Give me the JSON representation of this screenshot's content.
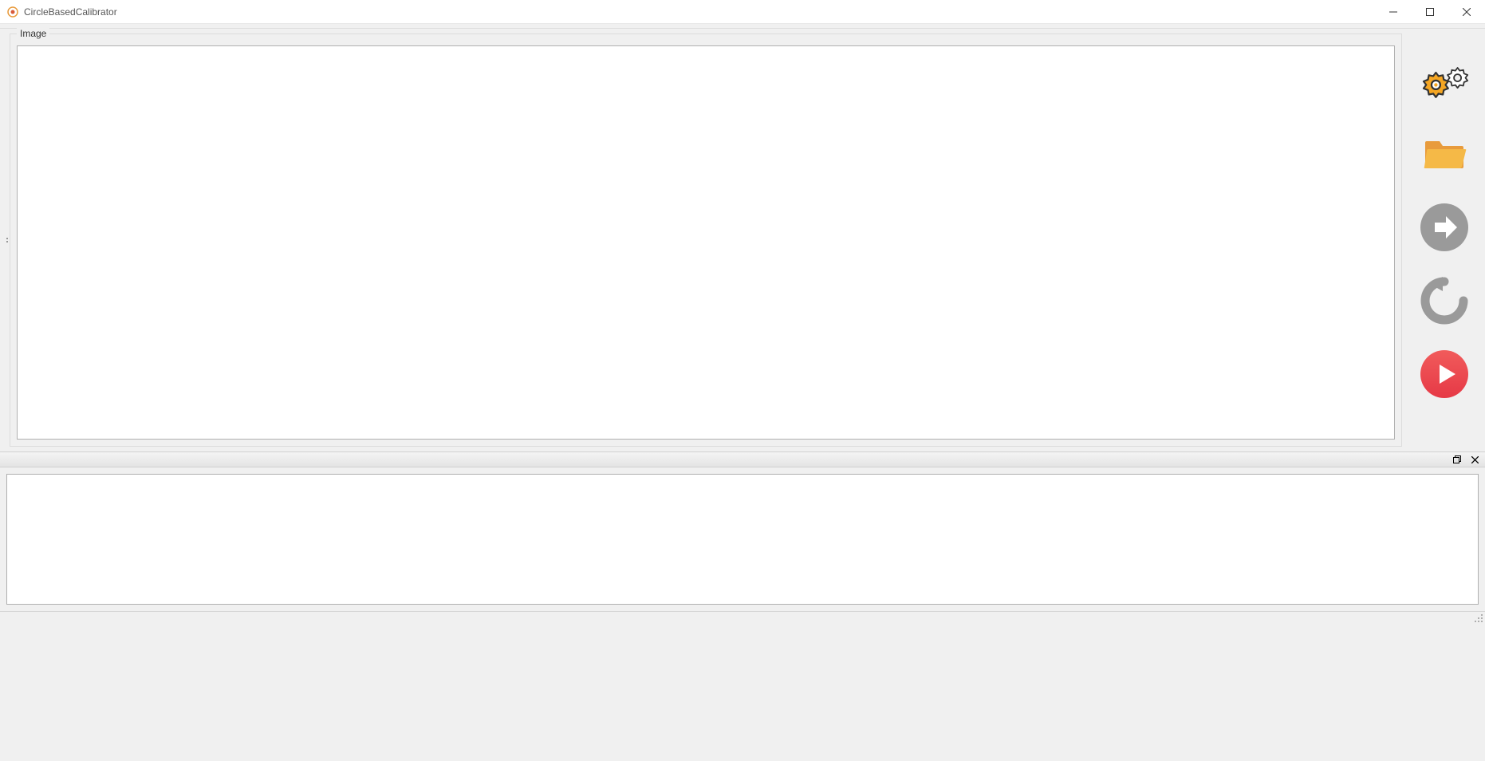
{
  "window": {
    "title": "CircleBasedCalibrator"
  },
  "groups": {
    "image_label": "Image"
  },
  "icons": {
    "settings": "settings-icon",
    "folder": "folder-icon",
    "next": "arrow-right-icon",
    "reload": "reload-icon",
    "play": "play-icon"
  }
}
